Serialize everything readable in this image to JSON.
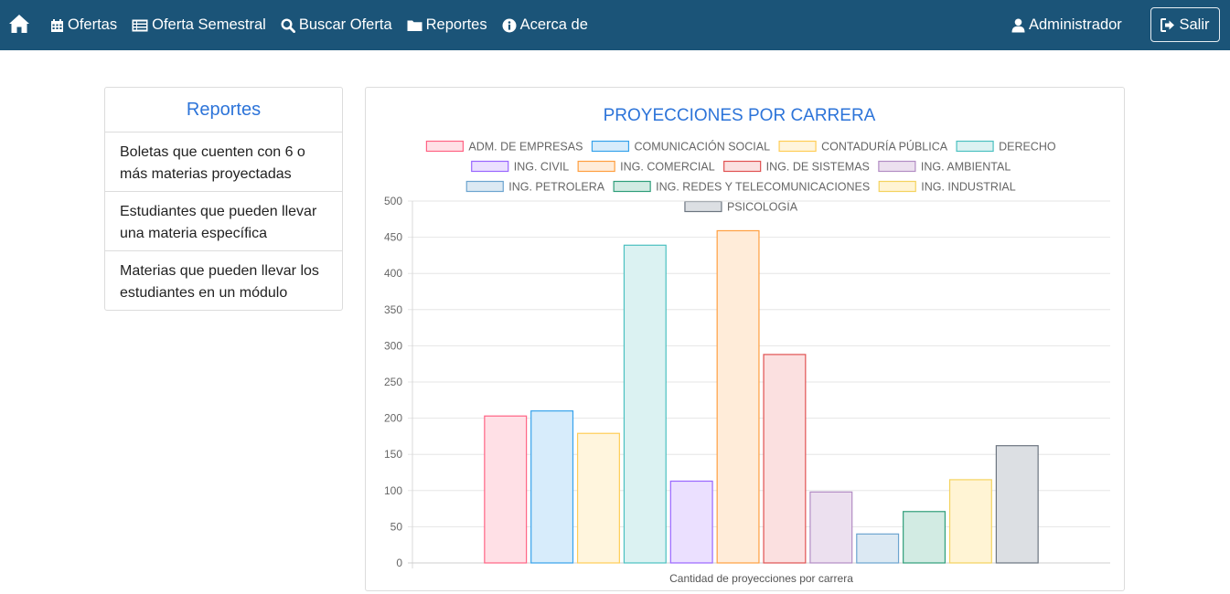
{
  "nav": {
    "items": [
      {
        "label": "Ofertas",
        "icon": "calendar-icon"
      },
      {
        "label": "Oferta Semestral",
        "icon": "list-card-icon"
      },
      {
        "label": "Buscar Oferta",
        "icon": "search-icon"
      },
      {
        "label": "Reportes",
        "icon": "folder-icon"
      },
      {
        "label": "Acerca de",
        "icon": "info-icon"
      }
    ],
    "user_label": "Administrador",
    "logout_label": "Salir"
  },
  "sidebar": {
    "title": "Reportes",
    "items": [
      {
        "label": "Boletas que cuenten con 6 o más materias proyectadas"
      },
      {
        "label": "Estudiantes que pueden llevar una materia específica"
      },
      {
        "label": "Materias que pueden llevar los estudiantes en un módulo"
      }
    ]
  },
  "colors": {
    "navbar": "#1b5478",
    "accent": "#2d74d9"
  },
  "chart_data": {
    "type": "bar",
    "title": "PROYECCIONES POR CARRERA",
    "xlabel": "Cantidad de proyecciones por carrera",
    "ylabel": "",
    "ylim": [
      0,
      500
    ],
    "yticks": [
      0,
      50,
      100,
      150,
      200,
      250,
      300,
      350,
      400,
      450,
      500
    ],
    "grid": true,
    "legend_position": "top",
    "series": [
      {
        "name": "ADM. DE EMPRESAS",
        "value": 203,
        "fill": "#ffe0e6",
        "stroke": "#ff6384"
      },
      {
        "name": "COMUNICACIÓN SOCIAL",
        "value": 210,
        "fill": "#d7ecfb",
        "stroke": "#36a2eb"
      },
      {
        "name": "CONTADURÍA PÚBLICA",
        "value": 179,
        "fill": "#fff5dd",
        "stroke": "#ffcd56"
      },
      {
        "name": "DERECHO",
        "value": 439,
        "fill": "#dbf2f2",
        "stroke": "#4bc0c0"
      },
      {
        "name": "ING. CIVIL",
        "value": 113,
        "fill": "#ebe0ff",
        "stroke": "#9966ff"
      },
      {
        "name": "ING. COMERCIAL",
        "value": 459,
        "fill": "#ffecd9",
        "stroke": "#ff9f40"
      },
      {
        "name": "ING. DE SISTEMAS",
        "value": 288,
        "fill": "#fbe0e0",
        "stroke": "#e05252"
      },
      {
        "name": "ING. AMBIENTAL",
        "value": 98,
        "fill": "#ece0ef",
        "stroke": "#b28cc4"
      },
      {
        "name": "ING. PETROLERA",
        "value": 40,
        "fill": "#dce9f3",
        "stroke": "#6ca4cf"
      },
      {
        "name": "ING. REDES Y TELECOMUNICACIONES",
        "value": 71,
        "fill": "#d2ebe3",
        "stroke": "#2f9e7a"
      },
      {
        "name": "ING. INDUSTRIAL",
        "value": 115,
        "fill": "#fff4d4",
        "stroke": "#f4d35e"
      },
      {
        "name": "PSICOLOGÍA",
        "value": 162,
        "fill": "#dcdfe3",
        "stroke": "#6c7580"
      }
    ]
  }
}
